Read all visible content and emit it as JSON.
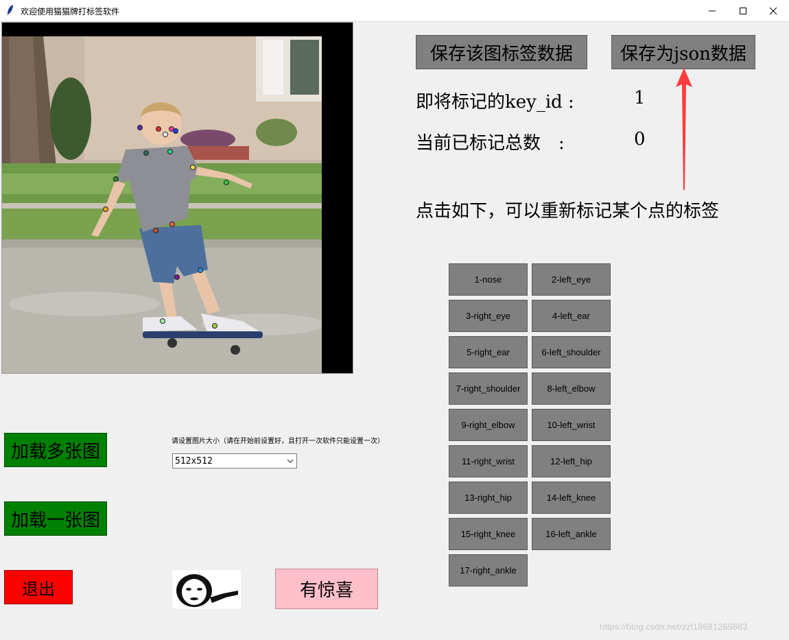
{
  "window": {
    "title": "欢迎使用猫猫牌打标签软件"
  },
  "toolbar": {
    "save_image_labels": "保存该图标签数据",
    "save_json": "保存为json数据"
  },
  "status": {
    "next_key_label": "即将标记的key_id :",
    "next_key_value": "1",
    "total_label": "当前已标记总数　:",
    "total_value": "0",
    "relabel_hint": "点击如下，可以重新标记某个点的标签"
  },
  "keypoints": [
    {
      "label": "1-nose"
    },
    {
      "label": "2-left_eye"
    },
    {
      "label": "3-right_eye"
    },
    {
      "label": "4-left_ear"
    },
    {
      "label": "5-right_ear"
    },
    {
      "label": "6-left_shoulder"
    },
    {
      "label": "7-right_shoulder"
    },
    {
      "label": "8-left_elbow"
    },
    {
      "label": "9-right_elbow"
    },
    {
      "label": "10-left_wrist"
    },
    {
      "label": "11-right_wrist"
    },
    {
      "label": "12-left_hip"
    },
    {
      "label": "13-right_hip"
    },
    {
      "label": "14-left_knee"
    },
    {
      "label": "15-right_knee"
    },
    {
      "label": "16-left_ankle"
    },
    {
      "label": "17-right_ankle"
    }
  ],
  "load": {
    "multi": "加载多张图",
    "single": "加载一张图"
  },
  "exit_label": "退出",
  "surprise_label": "有惊喜",
  "size_setting": {
    "hint": "请设置图片大小（请在开始前设置好，且打开一次软件只能设置一次）",
    "value": "512x512"
  },
  "watermark": "https://blog.csdn.net/zzl18681269883",
  "colors": {
    "green_button": "#008000",
    "red_button": "#ff0000",
    "pink_button": "#ffc0cb",
    "gray_button": "#808080",
    "arrow": "#ff3b3b"
  }
}
